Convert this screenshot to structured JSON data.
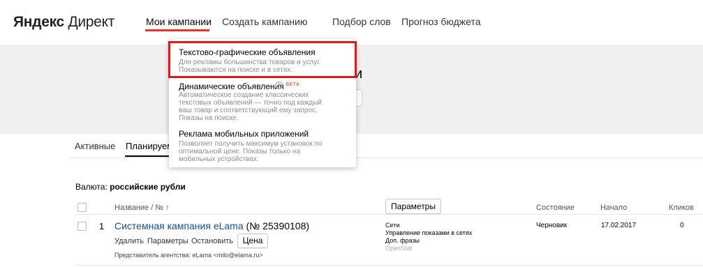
{
  "header": {
    "logo_brand": "Яндекс",
    "logo_product": "Директ",
    "nav": [
      {
        "label": "Мои кампании",
        "active": true
      },
      {
        "label": "Создать кампанию",
        "active": false
      },
      {
        "label": "Подбор слов",
        "active": false
      },
      {
        "label": "Прогноз бюджета",
        "active": false
      }
    ]
  },
  "page": {
    "title_fragment": "и"
  },
  "tabs": [
    {
      "label": "Активные"
    },
    {
      "label": "Планируем"
    }
  ],
  "currency": {
    "label": "Валюта:",
    "value": "российские рубли"
  },
  "table": {
    "params_button": "Параметры",
    "headers": {
      "name": "Название / № ↑",
      "state": "Состояние",
      "start": "Начало",
      "clicks": "Кликов"
    },
    "rows": [
      {
        "num": "1",
        "name": "Системная кампания eLama",
        "id": "(№ 25390108)",
        "actions": [
          "Удалить",
          "Параметры",
          "Остановить"
        ],
        "price_button": "Цена",
        "agent_label": "Представитель агентства:",
        "agent_value": "eLama <milo@elama.ru>",
        "strategy": [
          "Сети",
          "Управление показами в сетях",
          "Доп. фразы"
        ],
        "strategy_muted": "OpenStat",
        "state": "Черновик",
        "start": "17.02.2017",
        "clicks": "0"
      }
    ]
  },
  "dropdown": {
    "items": [
      {
        "title": "Текстово-графические объявления",
        "desc": [
          "Для рекламы большинства товаров и услуг.",
          "Показываются на поиске и в сетях."
        ],
        "highlighted": true
      },
      {
        "title": "Динамические объявления",
        "badge": "БЕТА",
        "help": "?",
        "desc": [
          "Автоматическое создание классических",
          "текстовых объявлений — точно под каждый",
          "ваш товар и соответствующий ему запрос.",
          "Показы на поиске."
        ]
      },
      {
        "title": "Реклама мобильных приложений",
        "desc": [
          "Позволяет получить максимум установок по",
          "оптимальной цене. Показы только на",
          "мобильных устройствах."
        ]
      }
    ]
  },
  "colors": {
    "accent": "#e32222",
    "link": "#1a4d8c",
    "highlight_border": "#e01818",
    "gray_band": "#f0f0f0"
  }
}
